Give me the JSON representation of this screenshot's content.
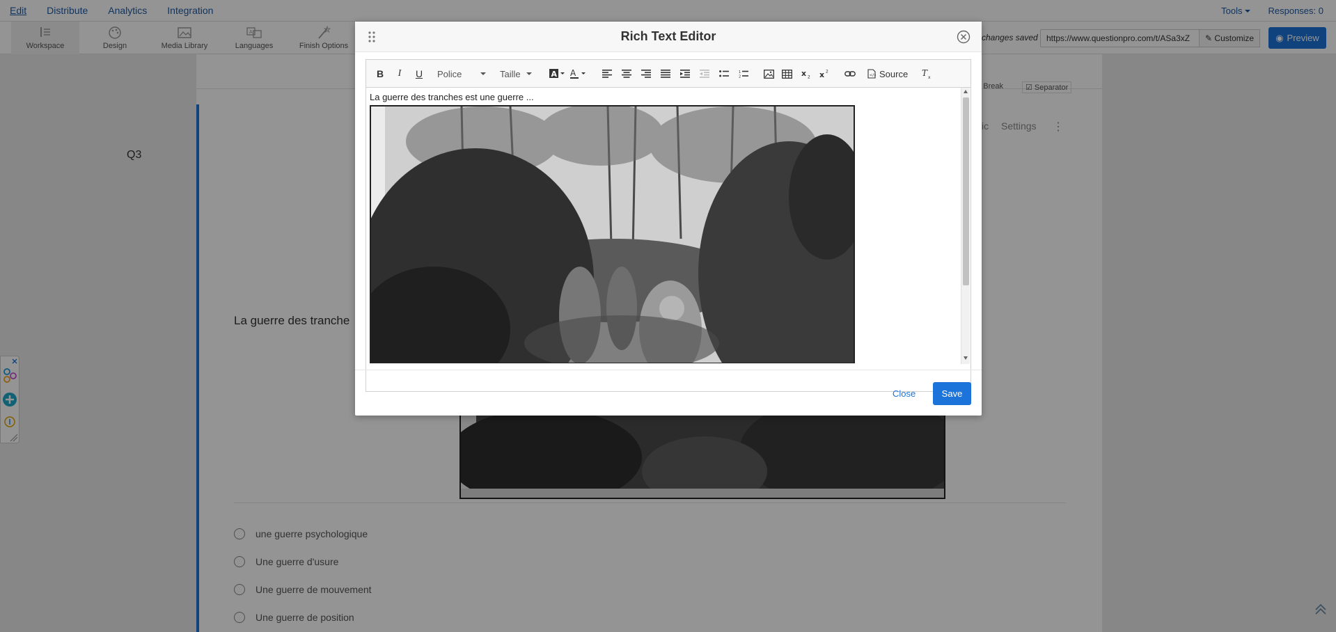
{
  "topnav": {
    "items": [
      {
        "label": "Edit",
        "active": true
      },
      {
        "label": "Distribute"
      },
      {
        "label": "Analytics"
      },
      {
        "label": "Integration"
      }
    ],
    "tools_label": "Tools",
    "responses_label": "Responses: 0"
  },
  "toolbar": {
    "tools": [
      {
        "label": "Workspace",
        "icon": "workspace-icon",
        "active": true
      },
      {
        "label": "Design",
        "icon": "palette-icon"
      },
      {
        "label": "Media Library",
        "icon": "image-icon"
      },
      {
        "label": "Languages",
        "icon": "translate-icon"
      },
      {
        "label": "Finish Options",
        "icon": "magic-wand-icon"
      }
    ],
    "saved_text": "changes saved",
    "url": "https://www.questionpro.com/t/ASa3xZ",
    "customize_label": "Customize",
    "preview_label": "Preview"
  },
  "canvas": {
    "page_break_label": "ge Break",
    "separator_label": "Separator",
    "question_number": "Q3",
    "question_text": "La guerre des tranche",
    "logic_tail": "ic",
    "settings_label": "Settings",
    "options": [
      "une guerre psychologique",
      "Une guerre d'usure",
      "Une guerre de mouvement",
      "Une guerre de position"
    ]
  },
  "modal": {
    "title": "Rich Text Editor",
    "font_label": "Police",
    "size_label": "Taille",
    "source_label": "Source",
    "content_text": "La guerre des tranches est une guerre ...",
    "close_label": "Close",
    "save_label": "Save"
  },
  "colors": {
    "accent": "#1c73d9",
    "nav_link": "#1c5aa6",
    "overlay": "rgba(0,0,0,0.42)"
  }
}
